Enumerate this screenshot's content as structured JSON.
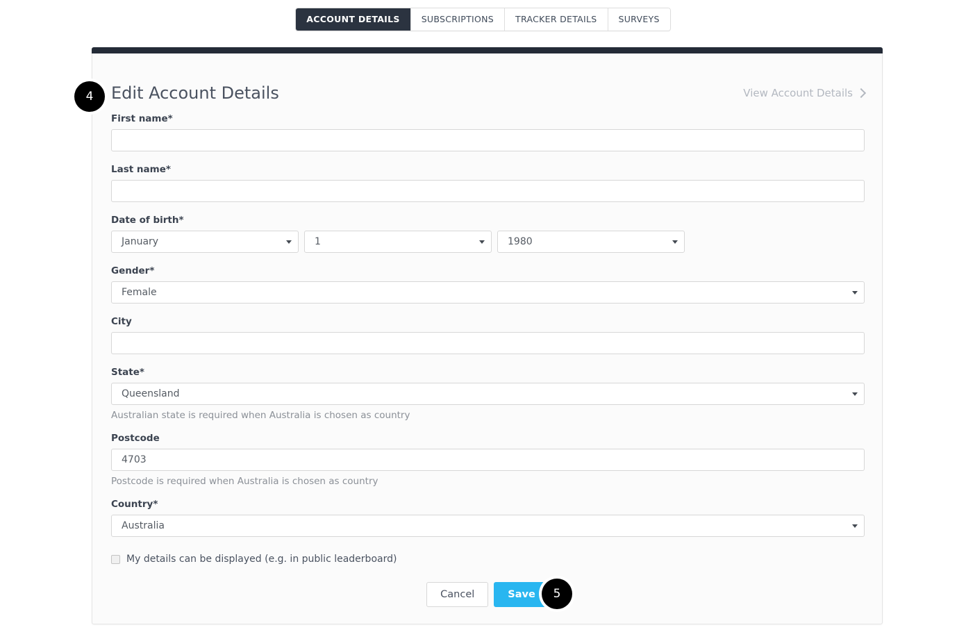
{
  "tabs": [
    {
      "label": "ACCOUNT DETAILS",
      "active": true
    },
    {
      "label": "SUBSCRIPTIONS",
      "active": false
    },
    {
      "label": "TRACKER DETAILS",
      "active": false
    },
    {
      "label": "SURVEYS",
      "active": false
    }
  ],
  "card": {
    "title": "Edit Account Details",
    "view_link": "View Account Details",
    "view_link_icon": "chevron-right-icon"
  },
  "badges": {
    "step_four": "4",
    "step_five": "5"
  },
  "form": {
    "first_name": {
      "label": "First name*",
      "value": "",
      "placeholder": ""
    },
    "last_name": {
      "label": "Last name*",
      "value": "",
      "placeholder": ""
    },
    "date_of_birth": {
      "label": "Date of birth*",
      "month": "January",
      "day": "1",
      "year": "1980"
    },
    "gender": {
      "label": "Gender*",
      "value": "Female"
    },
    "city": {
      "label": "City",
      "value": "",
      "placeholder": ""
    },
    "state": {
      "label": "State*",
      "value": "Queensland",
      "helper": "Australian state is required when Australia is chosen as country"
    },
    "postcode": {
      "label": "Postcode",
      "value": "4703",
      "helper": "Postcode is required when Australia is chosen as country"
    },
    "country": {
      "label": "Country*",
      "value": "Australia"
    },
    "display_details": {
      "label": "My details can be displayed (e.g. in public leaderboard)",
      "checked": false
    }
  },
  "buttons": {
    "cancel": "Cancel",
    "save": "Save"
  },
  "colors": {
    "accent_blue": "#29b6f0",
    "dark_navy": "#242b37",
    "card_bg": "#fbfbfb",
    "badge_bg": "#000000"
  }
}
